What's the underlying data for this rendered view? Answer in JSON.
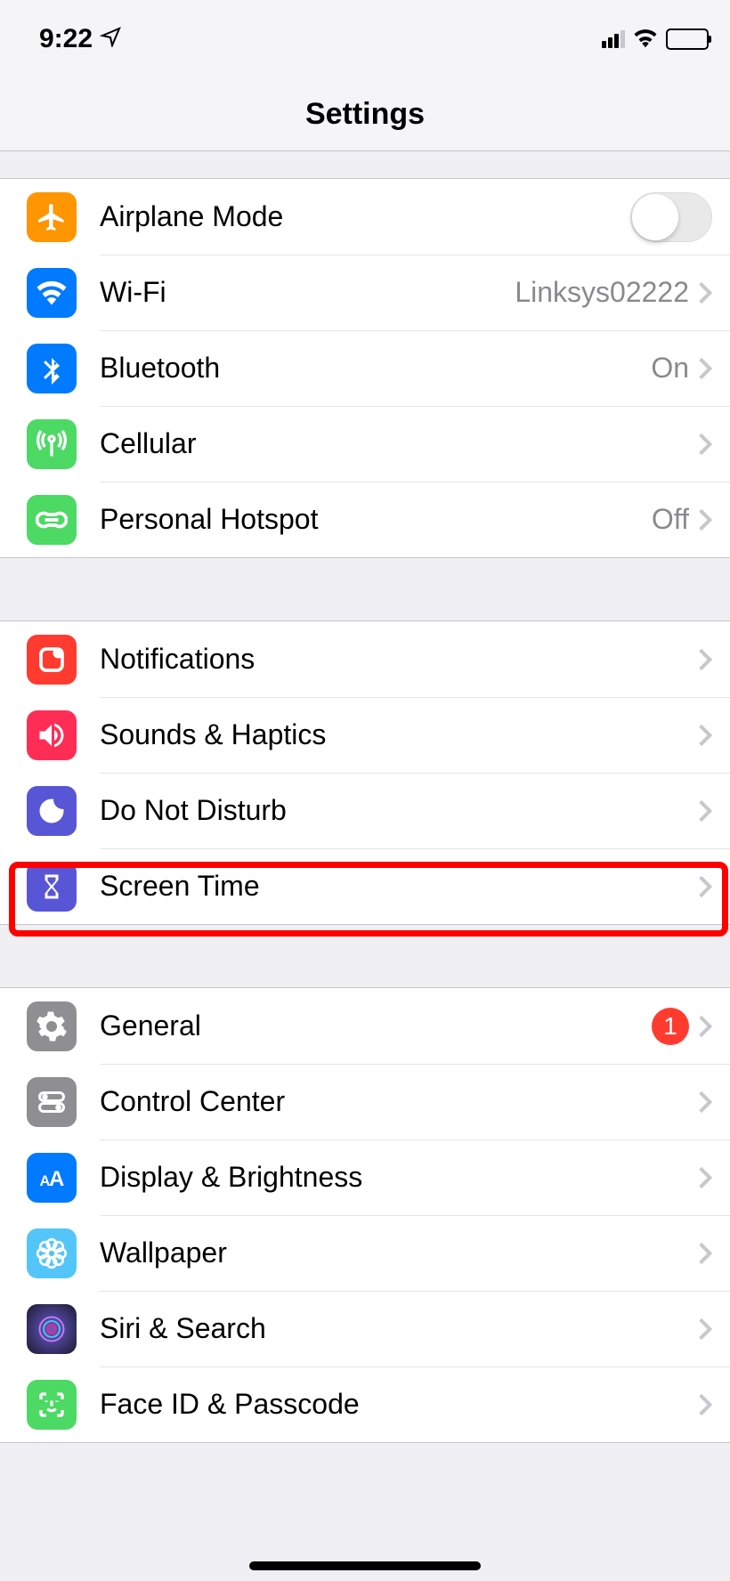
{
  "statusbar": {
    "time": "9:22"
  },
  "header": {
    "title": "Settings"
  },
  "sections": [
    {
      "rows": [
        {
          "id": "airplane-mode",
          "label": "Airplane Mode",
          "type": "toggle",
          "toggle": false,
          "icon": "airplane",
          "iconBg": "#ff9500"
        },
        {
          "id": "wifi",
          "label": "Wi-Fi",
          "type": "nav",
          "value": "Linksys02222",
          "icon": "wifi",
          "iconBg": "#007aff"
        },
        {
          "id": "bluetooth",
          "label": "Bluetooth",
          "type": "nav",
          "value": "On",
          "icon": "bluetooth",
          "iconBg": "#007aff"
        },
        {
          "id": "cellular",
          "label": "Cellular",
          "type": "nav",
          "icon": "cellular",
          "iconBg": "#4cd964"
        },
        {
          "id": "personal-hotspot",
          "label": "Personal Hotspot",
          "type": "nav",
          "value": "Off",
          "icon": "hotspot",
          "iconBg": "#4cd964"
        }
      ]
    },
    {
      "rows": [
        {
          "id": "notifications",
          "label": "Notifications",
          "type": "nav",
          "icon": "notifications",
          "iconBg": "#ff3b30"
        },
        {
          "id": "sounds-haptics",
          "label": "Sounds & Haptics",
          "type": "nav",
          "icon": "sounds",
          "iconBg": "#ff2d55"
        },
        {
          "id": "do-not-disturb",
          "label": "Do Not Disturb",
          "type": "nav",
          "icon": "moon",
          "iconBg": "#5856d6"
        },
        {
          "id": "screen-time",
          "label": "Screen Time",
          "type": "nav",
          "icon": "hourglass",
          "iconBg": "#5856d6",
          "highlighted": true
        }
      ]
    },
    {
      "rows": [
        {
          "id": "general",
          "label": "General",
          "type": "nav",
          "badge": "1",
          "icon": "gear",
          "iconBg": "#8e8e93"
        },
        {
          "id": "control-center",
          "label": "Control Center",
          "type": "nav",
          "icon": "switches",
          "iconBg": "#8e8e93"
        },
        {
          "id": "display-brightness",
          "label": "Display & Brightness",
          "type": "nav",
          "icon": "textsize",
          "iconBg": "#007aff"
        },
        {
          "id": "wallpaper",
          "label": "Wallpaper",
          "type": "nav",
          "icon": "flower",
          "iconBg": "#54c5f8"
        },
        {
          "id": "siri-search",
          "label": "Siri & Search",
          "type": "nav",
          "icon": "siri",
          "iconBg": "#1a1a2e"
        },
        {
          "id": "faceid-passcode",
          "label": "Face ID & Passcode",
          "type": "nav",
          "icon": "faceid",
          "iconBg": "#4cd964"
        }
      ]
    }
  ]
}
